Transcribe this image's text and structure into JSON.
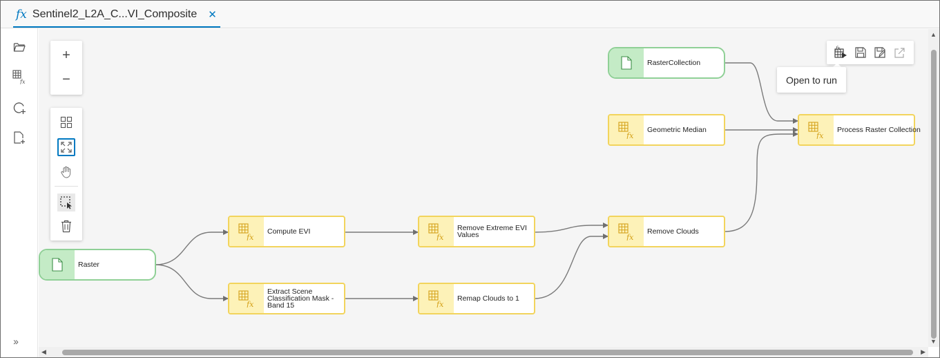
{
  "tab": {
    "title": "Sentinel2_L2A_C...VI_Composite",
    "icon": "function-icon",
    "close": "✕"
  },
  "tooltip": {
    "text": "Open to run"
  },
  "nodes": {
    "raster": "Raster",
    "compute_evi": "Compute EVI",
    "extract_scl_1": "Extract Scene",
    "extract_scl_2": "Classification Mask -",
    "extract_scl_3": "Band 15",
    "remove_extreme_1": "Remove Extreme EVI",
    "remove_extreme_2": "Values",
    "remap_clouds": "Remap Clouds to 1",
    "remove_clouds": "Remove Clouds",
    "raster_collection": "RasterCollection",
    "geometric_median": "Geometric Median",
    "process_raster_collection": "Process Raster Collection"
  },
  "colors": {
    "accent": "#0079c1",
    "function_border": "#f2d45c",
    "function_fill": "#fdf2b8",
    "data_border": "#8fd096",
    "data_fill": "#c4ebc6",
    "edge": "#7a7a7a"
  }
}
